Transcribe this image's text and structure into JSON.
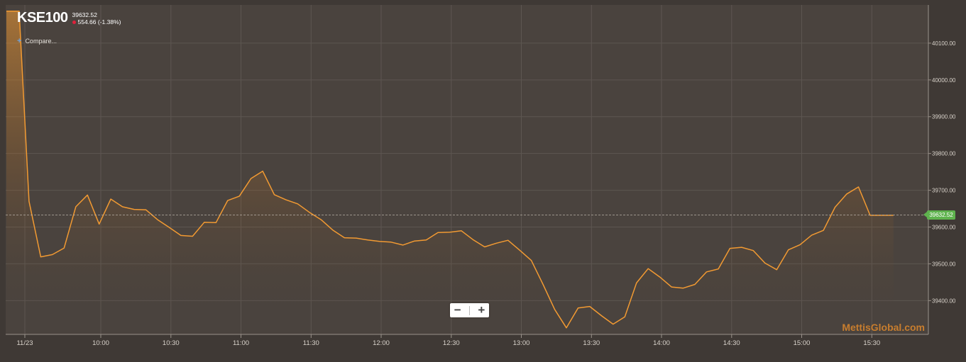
{
  "ticker": "KSE100",
  "last_price": "39632.52",
  "change_text": "554.66 (-1.38%)",
  "compare_label": "Compare...",
  "compare_plus": "+",
  "zoom_out_label": "−",
  "zoom_in_label": "+",
  "watermark": "MettisGlobal.com",
  "price_tag": "39632.52",
  "colors": {
    "line": "#f29a32",
    "up": "#5fb34e",
    "down": "#e0213b",
    "brand": "#c77d2e"
  },
  "chart_data": {
    "type": "area",
    "title": "",
    "xlabel": "",
    "ylabel": "",
    "x_ticks": [
      "11/23",
      "10:00",
      "10:30",
      "11:00",
      "11:30",
      "12:00",
      "12:30",
      "13:00",
      "13:30",
      "14:00",
      "14:30",
      "15:00",
      "15:30"
    ],
    "y_ticks": [
      "39400.00",
      "39500.00",
      "39600.00",
      "39700.00",
      "39800.00",
      "39900.00",
      "40000.00",
      "40100.00"
    ],
    "ylim": [
      39300,
      40200
    ],
    "current_value": 39632.52,
    "grid": true,
    "series": [
      {
        "x": [
          "09:30",
          "09:35",
          "09:40",
          "09:45",
          "09:50",
          "09:55",
          "10:00",
          "10:05",
          "10:10",
          "10:15",
          "10:20",
          "10:25",
          "10:30",
          "10:35",
          "10:40",
          "10:45",
          "10:50",
          "10:55",
          "11:00",
          "11:05",
          "11:10",
          "11:15",
          "11:20",
          "11:25",
          "11:30",
          "11:35",
          "11:40",
          "11:45",
          "11:50",
          "11:55",
          "12:00",
          "12:05",
          "12:10",
          "12:15",
          "12:20",
          "12:25",
          "12:30",
          "12:35",
          "12:40",
          "12:45",
          "12:50",
          "12:55",
          "13:00",
          "13:05",
          "13:10",
          "13:15",
          "13:20",
          "13:25",
          "13:30",
          "13:35",
          "13:40",
          "13:45",
          "13:50",
          "13:55",
          "14:00",
          "14:05",
          "14:10",
          "14:15",
          "14:20",
          "14:25",
          "14:30",
          "14:35",
          "14:40",
          "14:45",
          "14:50",
          "14:55",
          "15:00",
          "15:05",
          "15:10",
          "15:15",
          "15:20",
          "15:25",
          "15:30",
          "15:35",
          "15:40",
          "15:45",
          "15:50"
        ],
        "values": [
          40187,
          40187,
          39670,
          39519,
          39525,
          39543,
          39655,
          39687,
          39608,
          39676,
          39655,
          39648,
          39647,
          39620,
          39599,
          39577,
          39575,
          39613,
          39612,
          39672,
          39684,
          39732,
          39752,
          39688,
          39674,
          39663,
          39640,
          39620,
          39592,
          39571,
          39570,
          39565,
          39561,
          39559,
          39551,
          39562,
          39565,
          39585,
          39586,
          39590,
          39566,
          39546,
          39556,
          39564,
          39537,
          39509,
          39444,
          39376,
          39326,
          39380,
          39384,
          39359,
          39336,
          39356,
          39448,
          39487,
          39464,
          39437,
          39434,
          39444,
          39478,
          39486,
          39542,
          39545,
          39536,
          39502,
          39484,
          39538,
          39552,
          39578,
          39591,
          39654,
          39690,
          39709,
          39632,
          39632,
          39632
        ]
      }
    ]
  }
}
